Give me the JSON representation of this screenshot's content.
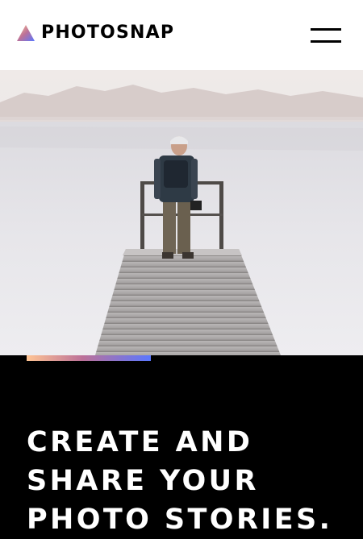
{
  "header": {
    "logo_text": "PHOTOSNAP",
    "logo_icon": "triangle-logo-icon",
    "menu_icon": "hamburger-menu-icon"
  },
  "hero": {
    "image": "man-standing-on-pier-lake-photo",
    "title_lines": [
      "CREATE AND",
      "SHARE YOUR",
      "PHOTO STORIES."
    ]
  },
  "colors": {
    "header_bg": "#ffffff",
    "content_bg": "#000000",
    "text_dark": "#000000",
    "text_light": "#ffffff",
    "accent_gradient": [
      "#ffc593",
      "#bc7198",
      "#5a77ff"
    ]
  }
}
